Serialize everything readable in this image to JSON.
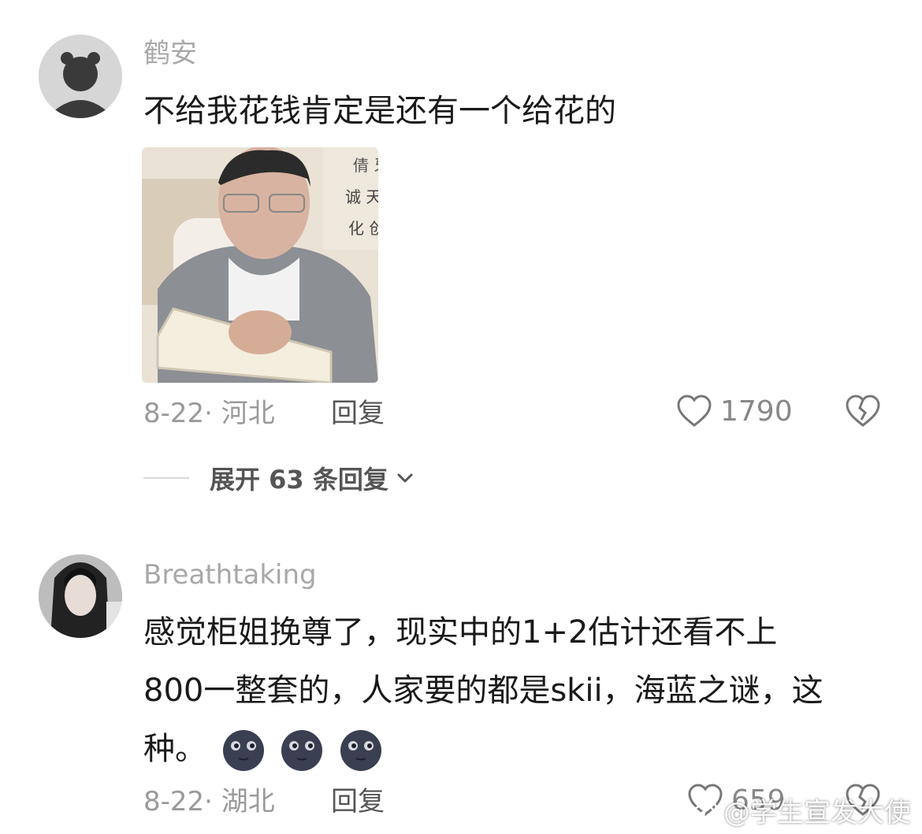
{
  "comments": [
    {
      "username": "鹤安",
      "text": "不给我花钱肯定是还有一个给花的",
      "date_location": "8-22· 河北",
      "reply_label": "回复",
      "like_count": "1790",
      "expand_label": "展开 63 条回复"
    },
    {
      "username": "Breathtaking",
      "text_line1": "感觉柜姐挽尊了，现实中的1+2估计还看不上",
      "text_line2": "800一整套的，人家要的都是skii，海蓝之谜，这",
      "text_line3": "种。",
      "date_location": "8-22· 湖北",
      "reply_label": "回复",
      "like_count": "659"
    }
  ],
  "watermark": "@学生宣发大使",
  "icons": {
    "like": "heart-outline-icon",
    "dislike": "broken-heart-icon",
    "expand": "chevron-down-icon",
    "emoji": "new-moon-face-emoji"
  },
  "colors": {
    "username": "#a8a8a8",
    "text": "#1a1a1a",
    "meta": "#9a9a9a"
  }
}
